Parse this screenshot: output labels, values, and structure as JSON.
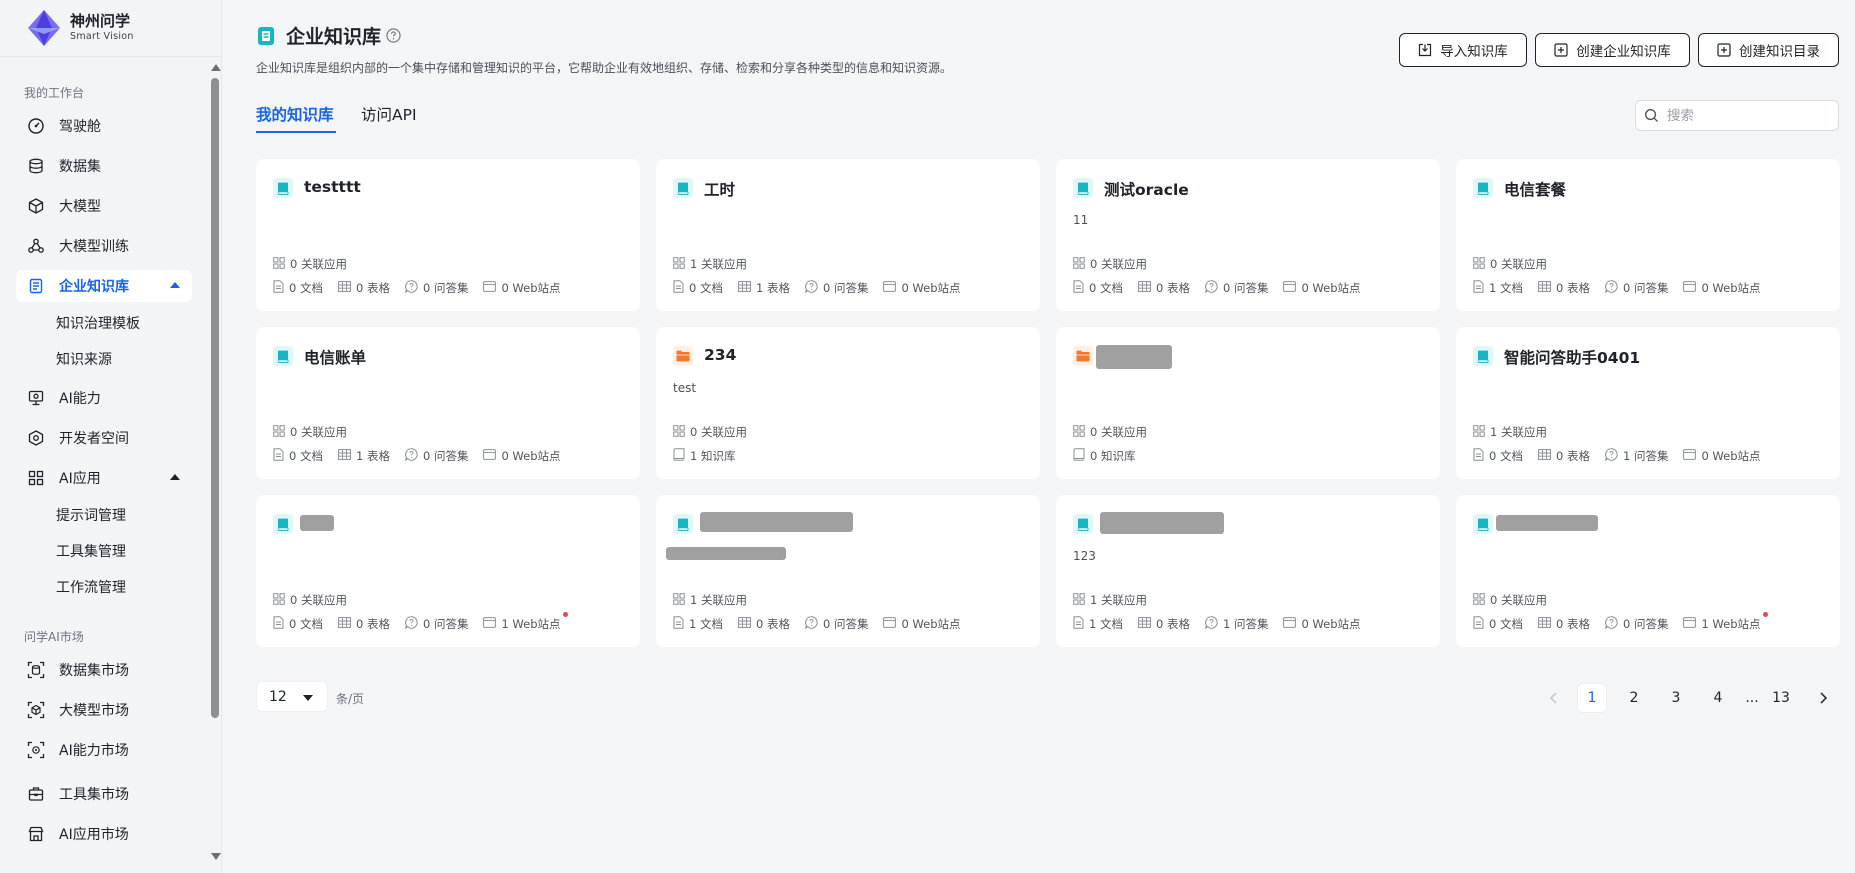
{
  "brand": {
    "title": "神州问学",
    "subtitle": "Smart Vision"
  },
  "sidebar": {
    "section_workspace": "我的工作台",
    "items": [
      {
        "label": "驾驶舱",
        "icon": "speedometer-icon"
      },
      {
        "label": "数据集",
        "icon": "database-icon"
      },
      {
        "label": "大模型",
        "icon": "cube-icon"
      },
      {
        "label": "大模型训练",
        "icon": "training-icon"
      },
      {
        "label": "企业知识库",
        "icon": "knowledge-base-icon",
        "active": true,
        "expanded": true
      },
      {
        "label": "AI能力",
        "icon": "ai-capability-icon"
      },
      {
        "label": "开发者空间",
        "icon": "developer-icon"
      },
      {
        "label": "AI应用",
        "icon": "apps-grid-icon",
        "expanded": true
      }
    ],
    "kb_sub": [
      "知识治理模板",
      "知识来源"
    ],
    "ai_app_sub": [
      "提示词管理",
      "工具集管理",
      "工作流管理"
    ],
    "section_market": "问学AI市场",
    "market_items": [
      {
        "label": "数据集市场",
        "icon": "dataset-market-icon"
      },
      {
        "label": "大模型市场",
        "icon": "model-market-icon"
      },
      {
        "label": "AI能力市场",
        "icon": "ai-market-icon"
      },
      {
        "label": "工具集市场",
        "icon": "toolbox-market-icon"
      },
      {
        "label": "AI应用市场",
        "icon": "app-market-icon"
      }
    ]
  },
  "header": {
    "title": "企业知识库",
    "description": "企业知识库是组织内部的一个集中存储和管理知识的平台，它帮助企业有效地组织、存储、检索和分享各种类型的信息和知识资源。",
    "buttons": {
      "import": "导入知识库",
      "create_kb": "创建企业知识库",
      "create_dir": "创建知识目录"
    }
  },
  "tabs": {
    "mine": "我的知识库",
    "api": "访问API"
  },
  "search": {
    "placeholder": "搜索"
  },
  "cards": [
    {
      "title": "testttt",
      "desc": "",
      "type": "book",
      "apps": "0 关联应用",
      "docs": "0 文档",
      "tables": "0 表格",
      "qa": "0 问答集",
      "web": "0 Web站点"
    },
    {
      "title": "工时",
      "desc": "",
      "type": "book",
      "apps": "1 关联应用",
      "docs": "0 文档",
      "tables": "1 表格",
      "qa": "0 问答集",
      "web": "0 Web站点"
    },
    {
      "title": "测试oracle",
      "desc": "11",
      "type": "book",
      "apps": "0 关联应用",
      "docs": "0 文档",
      "tables": "0 表格",
      "qa": "0 问答集",
      "web": "0 Web站点"
    },
    {
      "title": "电信套餐",
      "desc": "",
      "type": "book",
      "apps": "0 关联应用",
      "docs": "1 文档",
      "tables": "0 表格",
      "qa": "0 问答集",
      "web": "0 Web站点"
    },
    {
      "title": "电信账单",
      "desc": "",
      "type": "book",
      "apps": "0 关联应用",
      "docs": "0 文档",
      "tables": "1 表格",
      "qa": "0 问答集",
      "web": "0 Web站点"
    },
    {
      "title": "234",
      "desc": "test",
      "type": "folder",
      "apps": "0 关联应用",
      "kbs": "1 知识库"
    },
    {
      "title": "",
      "desc": "",
      "type": "folder",
      "apps": "0 关联应用",
      "kbs": "0 知识库"
    },
    {
      "title": "智能问答助手0401",
      "desc": "",
      "type": "book",
      "apps": "1 关联应用",
      "docs": "0 文档",
      "tables": "0 表格",
      "qa": "1 问答集",
      "web": "0 Web站点"
    },
    {
      "title": "",
      "desc": "",
      "type": "book",
      "apps": "0 关联应用",
      "docs": "0 文档",
      "tables": "0 表格",
      "qa": "0 问答集",
      "web": "1 Web站点"
    },
    {
      "title": "",
      "desc": "",
      "type": "book",
      "apps": "1 关联应用",
      "docs": "1 文档",
      "tables": "0 表格",
      "qa": "0 问答集",
      "web": "0 Web站点"
    },
    {
      "title": "",
      "desc": "123",
      "type": "book",
      "apps": "1 关联应用",
      "docs": "1 文档",
      "tables": "0 表格",
      "qa": "1 问答集",
      "web": "0 Web站点"
    },
    {
      "title": "",
      "desc": "",
      "type": "book",
      "apps": "0 关联应用",
      "docs": "0 文档",
      "tables": "0 表格",
      "qa": "0 问答集",
      "web": "1 Web站点"
    }
  ],
  "pagination": {
    "page_size": "12",
    "unit": "条/页",
    "pages": [
      "1",
      "2",
      "3",
      "4"
    ],
    "ellipsis": "...",
    "last": "13",
    "current": "1"
  },
  "colors": {
    "accent": "#1864e8",
    "book_icon": "#17b5c2",
    "folder_icon": "#f5772e",
    "dot": "#f0434b"
  }
}
